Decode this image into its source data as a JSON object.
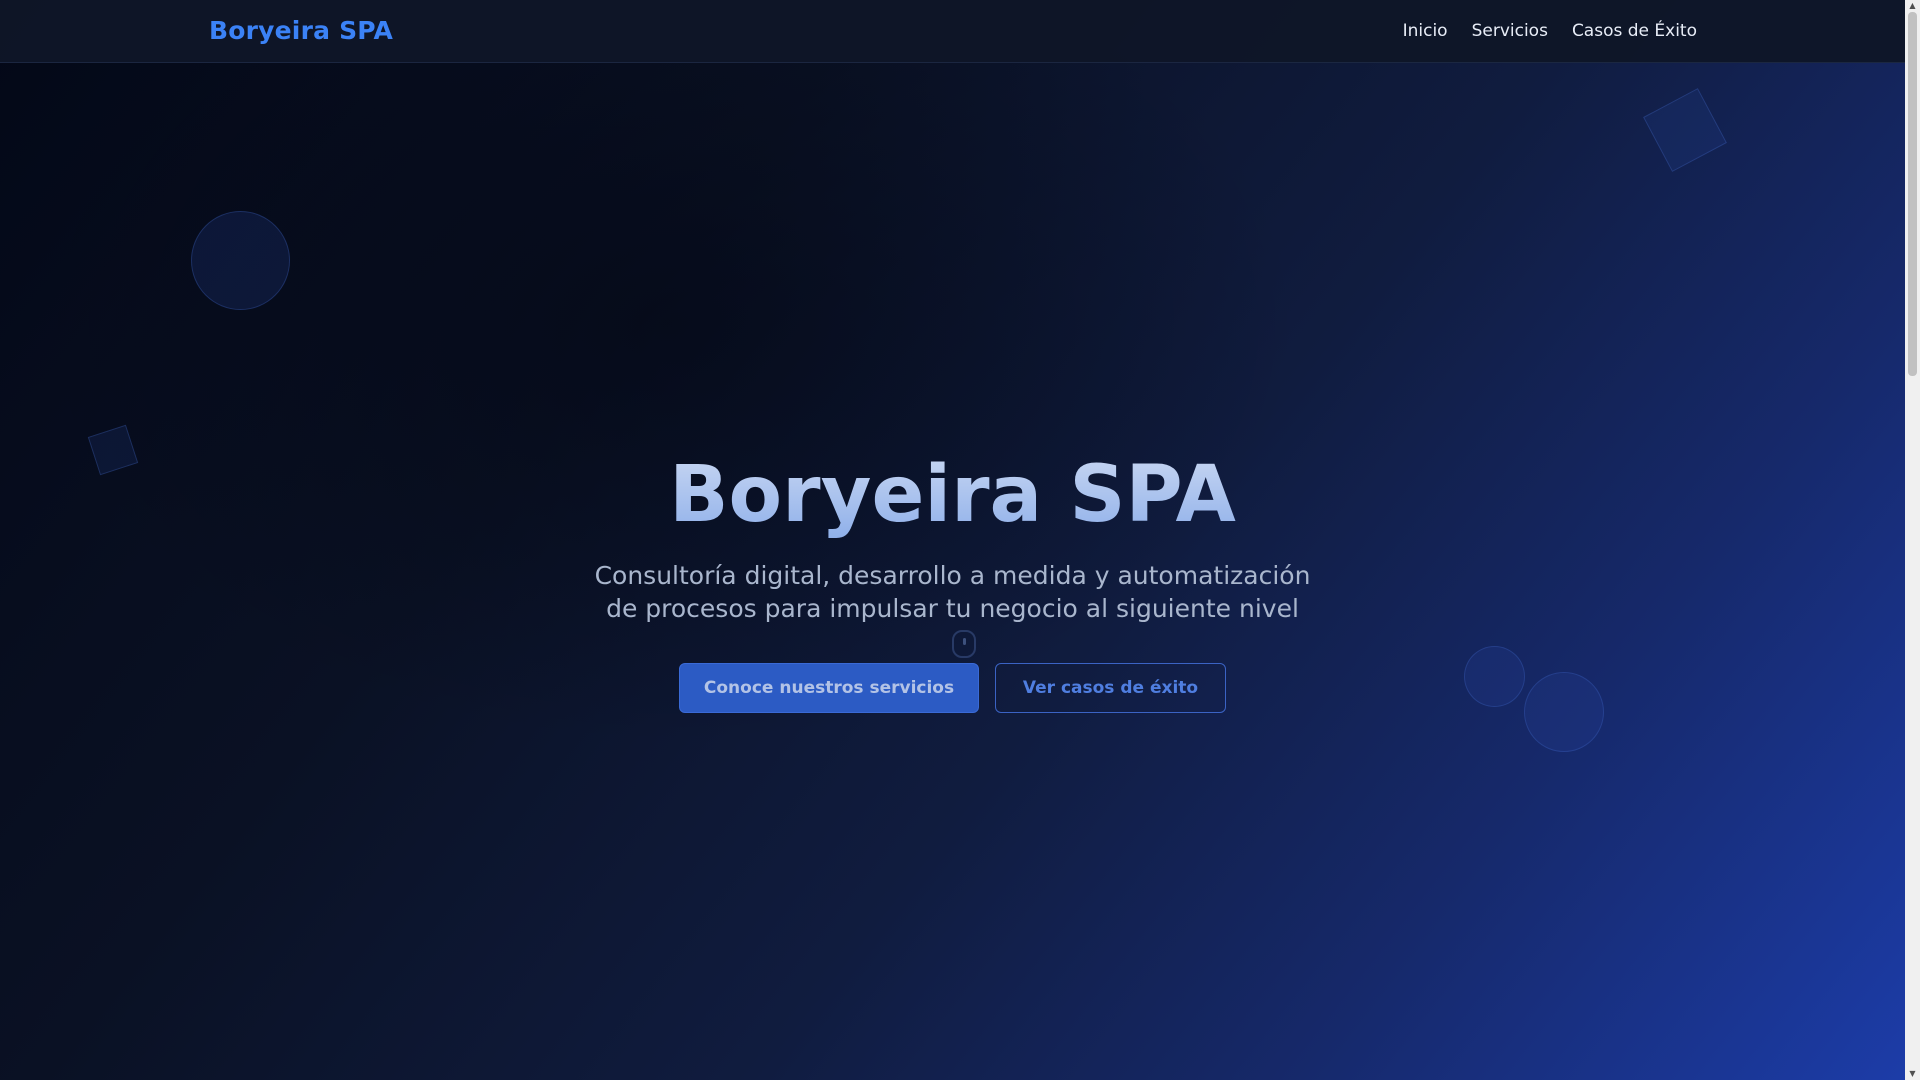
{
  "navbar": {
    "brand": "Boryeira SPA",
    "links": [
      {
        "label": "Inicio"
      },
      {
        "label": "Servicios"
      },
      {
        "label": "Casos de Éxito"
      }
    ]
  },
  "hero": {
    "title": "Boryeira SPA",
    "subtitle": "Consultoría digital, desarrollo a medida y automatización de procesos para impulsar tu negocio al siguiente nivel",
    "primary_button": "Conoce nuestros servicios",
    "secondary_button": "Ver casos de éxito"
  },
  "colors": {
    "brand": "#3b82f6",
    "primary_button": "#2c5bc4",
    "background_dark": "#050b1a",
    "background_accent": "#1c3ca8"
  },
  "icons": {
    "scroll_up": "triangle-up-icon",
    "scroll_down": "triangle-down-icon",
    "scroll_indicator": "mouse-scroll-icon"
  }
}
